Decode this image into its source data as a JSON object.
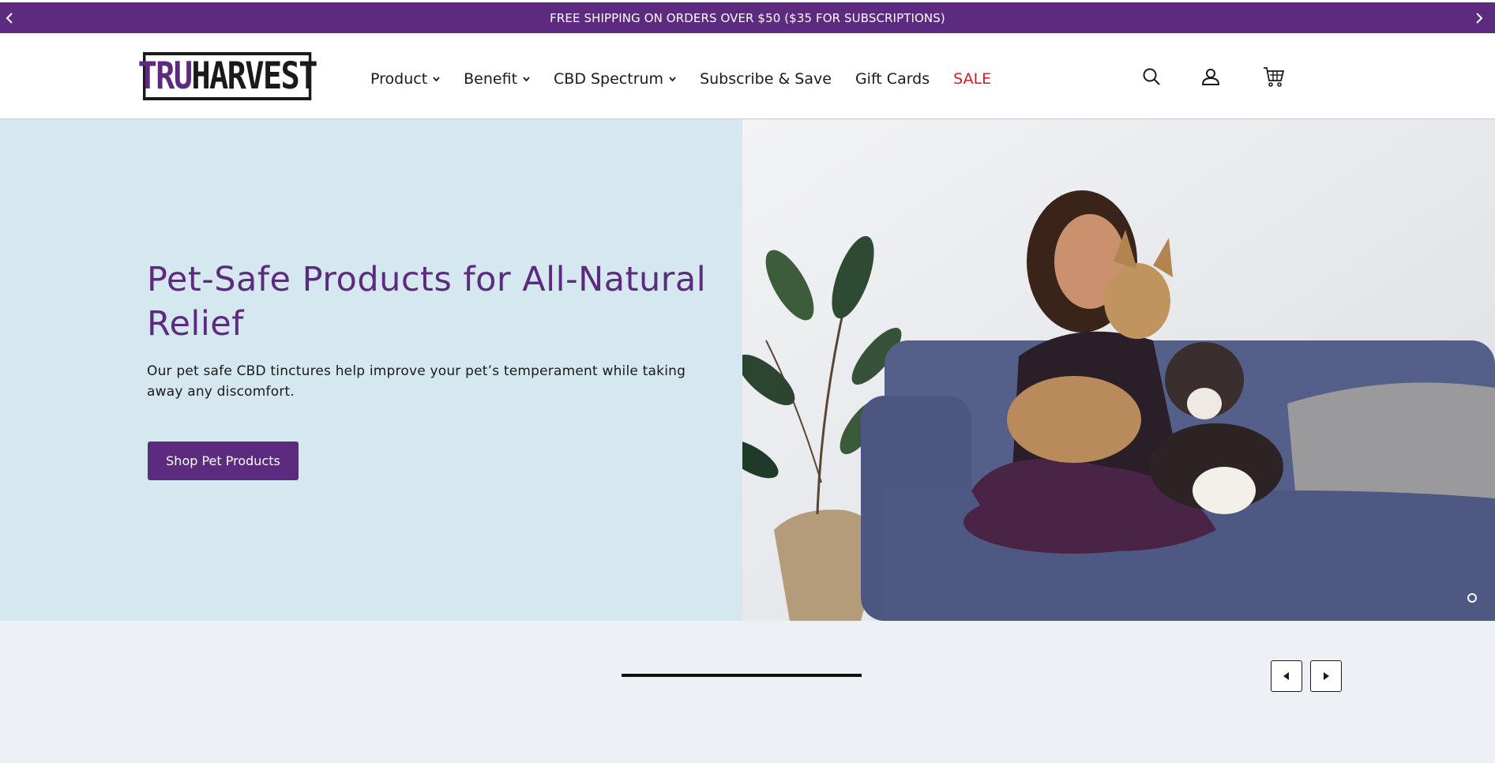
{
  "announcement": {
    "text": "FREE SHIPPING ON ORDERS OVER $50 ($35 FOR SUBSCRIPTIONS)",
    "prev_icon": "chevron-left-icon",
    "next_icon": "chevron-right-icon"
  },
  "brand": {
    "logo_tru": "TRU",
    "logo_harvest": "HARVEST"
  },
  "nav": {
    "items": [
      {
        "label": "Product",
        "dropdown": true
      },
      {
        "label": "Benefit",
        "dropdown": true
      },
      {
        "label": "CBD Spectrum",
        "dropdown": true
      },
      {
        "label": "Subscribe & Save",
        "dropdown": false
      },
      {
        "label": "Gift Cards",
        "dropdown": false
      },
      {
        "label": "SALE",
        "dropdown": false
      }
    ]
  },
  "header_icons": {
    "search": "search-icon",
    "account": "account-icon",
    "cart": "cart-icon"
  },
  "hero": {
    "title": "Pet-Safe Products for All-Natural Relief",
    "subtitle": "Our pet safe CBD tinctures help improve your pet’s temperament while taking away any discomfort.",
    "cta_label": "Shop Pet Products"
  },
  "carousel": {
    "progress": 1.0
  },
  "colors": {
    "brand_purple": "#5c2a7e",
    "sale_red": "#e0141e",
    "hero_bg": "#d5e8f0",
    "lower_bg": "#edf1f5"
  }
}
